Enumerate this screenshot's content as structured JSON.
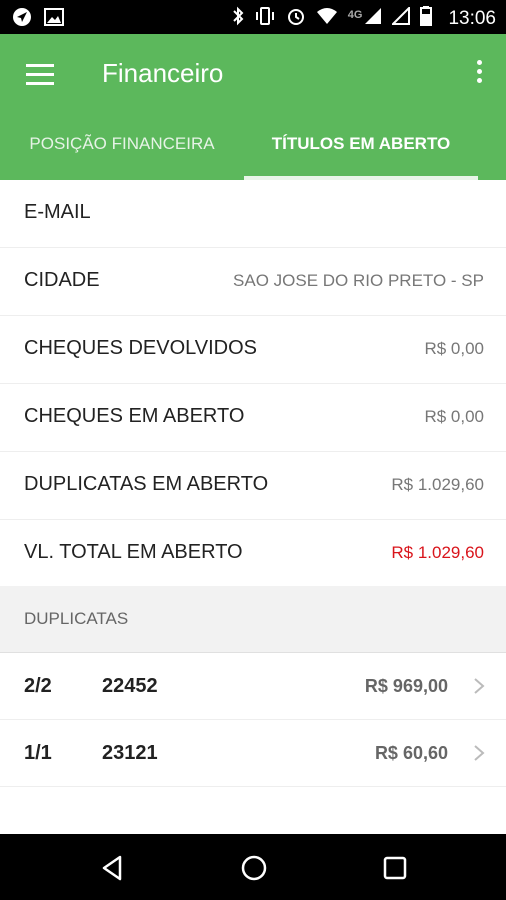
{
  "status_bar": {
    "time": "13:06",
    "network": "4G",
    "icons": [
      "navigation-icon",
      "image-icon",
      "bluetooth-icon",
      "vibrate-icon",
      "alarm-icon",
      "wifi-icon",
      "signal-icon",
      "signal-icon",
      "battery-icon"
    ]
  },
  "app_bar": {
    "title": "Financeiro",
    "menu_icon": "hamburger-icon",
    "overflow_icon": "more-vert-icon",
    "color": "#5cb85c"
  },
  "tabs": [
    {
      "label": "POSIÇÃO FINANCEIRA",
      "selected": false
    },
    {
      "label": "TÍTULOS EM ABERTO",
      "selected": true
    }
  ],
  "info_rows": [
    {
      "label": "E-MAIL",
      "value": ""
    },
    {
      "label": "CIDADE",
      "value": "SAO JOSE DO RIO PRETO - SP"
    },
    {
      "label": "CHEQUES DEVOLVIDOS",
      "value": "R$ 0,00"
    },
    {
      "label": "CHEQUES EM ABERTO",
      "value": "R$ 0,00"
    },
    {
      "label": "DUPLICATAS EM ABERTO",
      "value": "R$ 1.029,60"
    },
    {
      "label": "VL. TOTAL EM ABERTO",
      "value": "R$ 1.029,60",
      "highlight_color": "#d9141b"
    }
  ],
  "section_header": "DUPLICATAS",
  "duplicatas": [
    {
      "parcela": "2/2",
      "numero": "22452",
      "valor": "R$ 969,00"
    },
    {
      "parcela": "1/1",
      "numero": "23121",
      "valor": "R$ 60,60"
    }
  ],
  "nav_bar": {
    "icons": [
      "back-icon",
      "home-icon",
      "recents-icon"
    ]
  }
}
